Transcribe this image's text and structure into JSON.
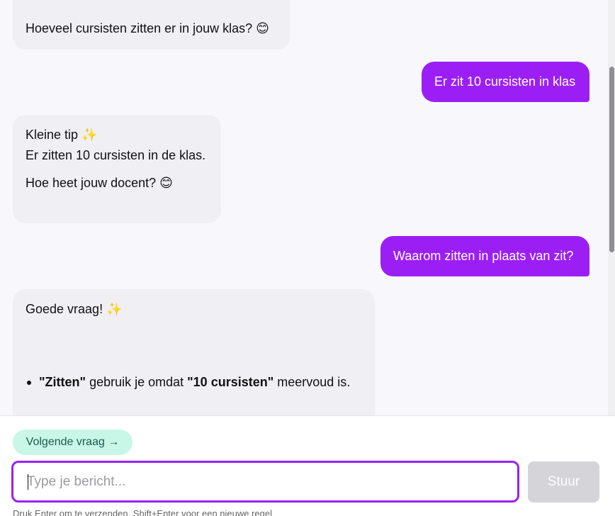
{
  "messages": [
    {
      "role": "bot",
      "lines": [
        "Hoeveel cursisten zitten er in jouw klas? 😊"
      ]
    },
    {
      "role": "user",
      "text": "Er zit 10 cursisten in klas"
    },
    {
      "role": "bot",
      "lines": [
        "Kleine tip ✨",
        "Er zitten 10 cursisten in de klas.",
        "Hoe heet jouw docent? 😊"
      ]
    },
    {
      "role": "user",
      "text": "Waarom zitten in plaats van zit?"
    },
    {
      "role": "bot",
      "intro": "Goede vraag! ✨",
      "bullet": {
        "term1": "\"Zitten\"",
        "mid": " gebruik je omdat ",
        "term2": "\"10 cursisten\"",
        "end": " meervoud is."
      }
    }
  ],
  "composer": {
    "next_label": "Volgende vraag →",
    "placeholder": "Type je bericht...",
    "send_label": "Stuur",
    "hint": "Druk Enter om te verzenden, Shift+Enter voor een nieuwe regel"
  },
  "colors": {
    "accent": "#9b1ff5",
    "next_bg": "#c8f7e8",
    "send_disabled": "#d4d4d9"
  }
}
